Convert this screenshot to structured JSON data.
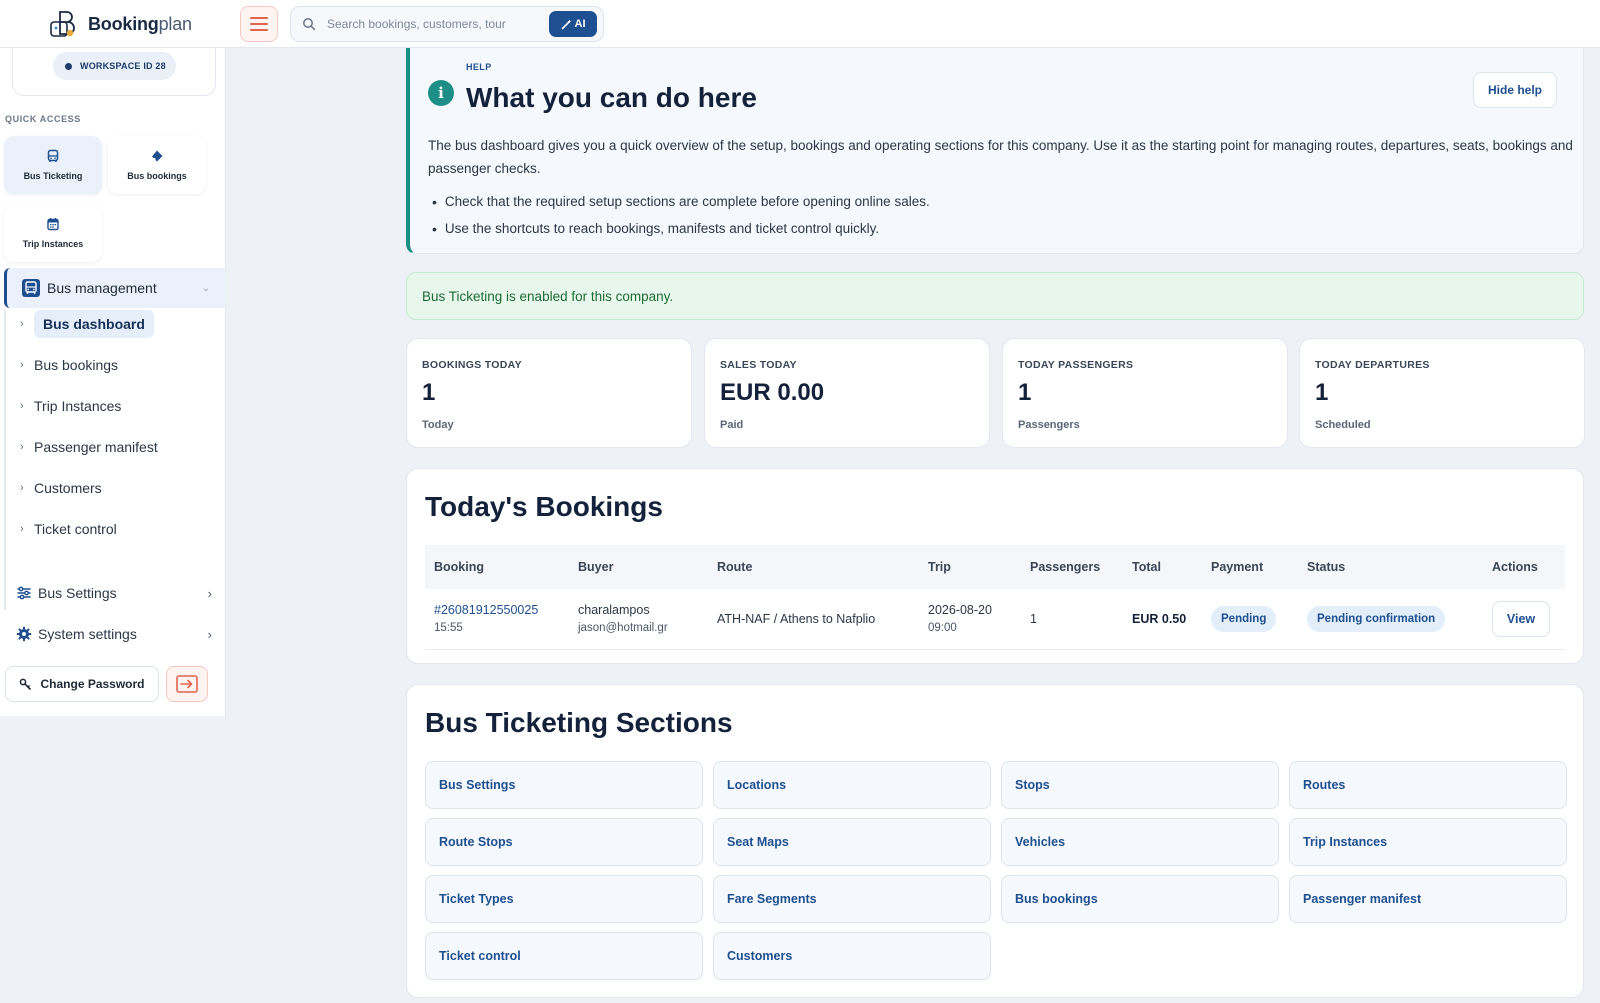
{
  "brand": {
    "name_bold": "Booking",
    "name_light": "plan"
  },
  "search": {
    "placeholder": "Search bookings, customers, tour",
    "ai_label": "AI"
  },
  "sidebar": {
    "workspace": "WORKSPACE ID 28",
    "quick_access_title": "QUICK ACCESS",
    "quick_access": [
      {
        "label": "Bus Ticketing",
        "icon": "bus-icon"
      },
      {
        "label": "Bus bookings",
        "icon": "ticket-icon"
      },
      {
        "label": "Trip Instances",
        "icon": "calendar-icon"
      }
    ],
    "parent": "Bus management",
    "items": [
      "Bus dashboard",
      "Bus bookings",
      "Trip Instances",
      "Passenger manifest",
      "Customers",
      "Ticket control"
    ],
    "groups": [
      "Bus Settings",
      "System settings"
    ],
    "change_password": "Change Password"
  },
  "help": {
    "kicker": "HELP",
    "title": "What you can do here",
    "hide_label": "Hide help",
    "body": "The bus dashboard gives you a quick overview of the setup, bookings and operating sections for this company. Use it as the starting point for managing routes, departures, seats, bookings and passenger checks.",
    "bullets": [
      "Check that the required setup sections are complete before opening online sales.",
      "Use the shortcuts to reach bookings, manifests and ticket control quickly."
    ]
  },
  "alert": "Bus Ticketing is enabled for this company.",
  "kpis": [
    {
      "label": "BOOKINGS TODAY",
      "value": "1",
      "sub": "Today"
    },
    {
      "label": "SALES TODAY",
      "value": "EUR 0.00",
      "sub": "Paid"
    },
    {
      "label": "TODAY PASSENGERS",
      "value": "1",
      "sub": "Passengers"
    },
    {
      "label": "TODAY DEPARTURES",
      "value": "1",
      "sub": "Scheduled"
    }
  ],
  "bookings": {
    "title": "Today's Bookings",
    "columns": [
      "Booking",
      "Buyer",
      "Route",
      "Trip",
      "Passengers",
      "Total",
      "Payment",
      "Status",
      "Actions"
    ],
    "rows": [
      {
        "booking": "#26081912550025",
        "booking_time": "15:55",
        "buyer": "charalampos",
        "buyer_email": "jason@hotmail.gr",
        "route": "ATH-NAF / Athens to Nafplio",
        "trip_date": "2026-08-20",
        "trip_time": "09:00",
        "passengers": "1",
        "total": "EUR 0.50",
        "payment": "Pending",
        "status": "Pending confirmation",
        "action": "View"
      }
    ]
  },
  "sections": {
    "title": "Bus Ticketing Sections",
    "items": [
      "Bus Settings",
      "Locations",
      "Stops",
      "Routes",
      "Route Stops",
      "Seat Maps",
      "Vehicles",
      "Trip Instances",
      "Ticket Types",
      "Fare Segments",
      "Bus bookings",
      "Passenger manifest",
      "Ticket control",
      "Customers"
    ]
  }
}
